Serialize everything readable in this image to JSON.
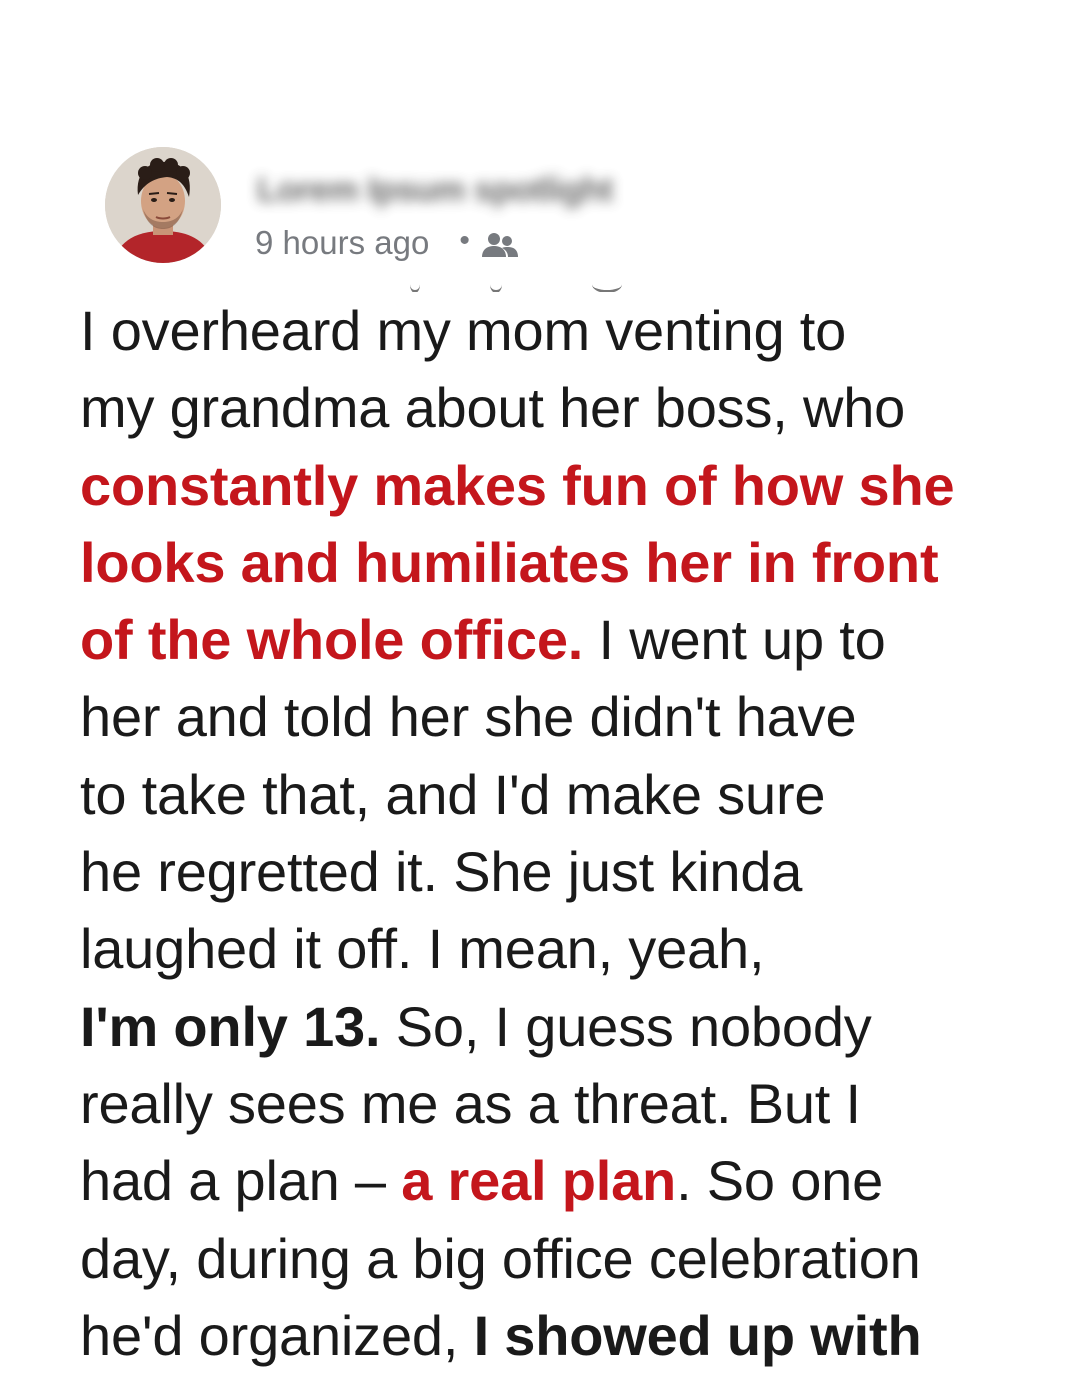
{
  "post": {
    "author_name": "Lorem Ipsum spotlight",
    "timestamp": "9 hours ago",
    "separator": "•",
    "audience_icon": "friends-icon"
  },
  "story": {
    "line_1": "I overheard my mom venting to",
    "line_2": "my grandma about her boss, who",
    "line_3_red": "constantly makes fun of how she",
    "line_4_red": "looks and humiliates her in front",
    "line_5_red": "of the whole office.",
    "line_5_tail": " I went up to",
    "line_6": "her and told her she didn't have",
    "line_7": "to take that, and I'd make sure",
    "line_8": "he regretted it. She just kinda",
    "line_9": "laughed it off. I mean, yeah,",
    "line_10_bold": "I'm only 13.",
    "line_10_tail": " So, I guess nobody",
    "line_11": "really sees me as a threat. But I",
    "line_12_head": "had a plan – ",
    "line_12_red": "a real plan",
    "line_12_tail": ". So one",
    "line_13": "day, during a big office celebration",
    "line_14_head": "he'd organized, ",
    "line_14_bold": "I showed up with"
  },
  "colors": {
    "highlight_red": "#c4161c",
    "body_text": "#1a1a1a",
    "meta_gray": "#777a7f"
  }
}
